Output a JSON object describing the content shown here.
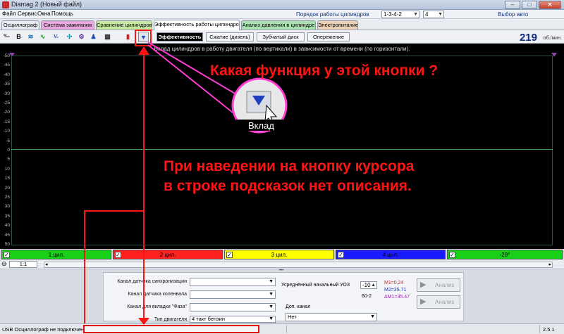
{
  "window": {
    "title": "Diamag 2 (Новый файл)"
  },
  "menu": {
    "items": [
      "Файл",
      "Сервис",
      "Окна",
      "Помощь"
    ]
  },
  "cylinder_order": {
    "label": "Порядок работы цилиндров",
    "value": "1-3-4-2",
    "cylinder_count": "4"
  },
  "auto_select": "Выбор авто",
  "tabs": [
    {
      "label": "Осциллограф",
      "color": "#e8ecf2"
    },
    {
      "label": "Система зажигания",
      "color": "#e7a8dd"
    },
    {
      "label": "Сравнение цилиндров",
      "color": "#c7e8a3"
    },
    {
      "label": "Эффективность работы цилиндров",
      "color": "#ffffff"
    },
    {
      "label": "Анализ давления в цилиндре",
      "color": "#a8e0b0"
    },
    {
      "label": "Электропитание",
      "color": "#e9d0b6"
    }
  ],
  "toolbar": {
    "icons": [
      {
        "glyph": "⁰⁄₁₀",
        "name": "scale-icon"
      },
      {
        "glyph": "B",
        "name": "bold-b-icon"
      },
      {
        "glyph": "≋",
        "name": "wave-icon"
      },
      {
        "glyph": "∿",
        "name": "line-chart-icon"
      },
      {
        "glyph": "⅟₂",
        "name": "fraction-icon"
      },
      {
        "glyph": "✣",
        "name": "person-icon"
      },
      {
        "glyph": "⚙",
        "name": "gear-icon"
      },
      {
        "glyph": "♟",
        "name": "figure-icon"
      },
      {
        "glyph": "▦",
        "name": "counter-icon"
      },
      {
        "glyph": "▮",
        "name": "bars-icon"
      },
      {
        "glyph": "▼",
        "name": "filter-funnel-icon"
      }
    ],
    "subtabs": [
      "Эффективность",
      "Сжатие (дизель)",
      "Зубчатый диск",
      "Опережение"
    ],
    "rpm_value": "219",
    "rpm_unit": "об./мин."
  },
  "plot": {
    "caption": "Вклад цилиндров в работу двигателя (по вертикали) в зависимости от времени (по горизонтали).",
    "y_ticks": [
      "-50",
      "-45",
      "-40",
      "-35",
      "-30",
      "-25",
      "-20",
      "-15",
      "-10",
      "-5",
      "0",
      "5",
      "10",
      "15",
      "20",
      "25",
      "30",
      "35",
      "40",
      "45",
      "50"
    ],
    "grid_line_color": "#3aa54a"
  },
  "channels": [
    {
      "label": "1 цил.",
      "color": "#18d018"
    },
    {
      "label": "2 цил.",
      "color": "#ff2020"
    },
    {
      "label": "3 цил.",
      "color": "#ffff00"
    },
    {
      "label": "4 цил.",
      "color": "#1a1aff"
    },
    {
      "label": "-29°",
      "color": "#18d018"
    }
  ],
  "zoom": "1:1",
  "form": {
    "sync_label": "Канал датчика синхронизации",
    "sync_value": "",
    "crank_label": "Канал датчика коленвала",
    "crank_value": "",
    "phase_label": "Канал для вкладки \"Фаза\"",
    "phase_value": "",
    "engine_label": "Тип двигателя",
    "engine_value": "4 такт бензин",
    "uoz_label": "Усреднённый начальный УОЗ",
    "uoz_value": "-10",
    "teeth_value": "60-2",
    "dop_label": "Доп. канал",
    "dop_value": "Нет",
    "m1": "M1=0.24",
    "m2": "M2=35.71",
    "dm": "ΔM1=35.47",
    "analyze_1": "Анализ",
    "analyze_2": "Анализ"
  },
  "status": {
    "usb": "USB Осциллограф не подключен",
    "version": "2.5.1"
  },
  "annotations": {
    "question": "Какая функция у этой кнопки ?",
    "zoom_label": "Вклад",
    "note_line1": "При наведении на кнопку курсора",
    "note_line2": "в строке подсказок нет описания."
  }
}
